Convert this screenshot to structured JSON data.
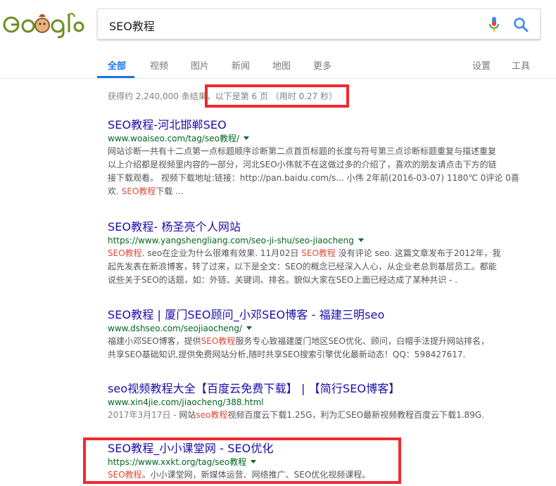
{
  "search": {
    "query": "SEO教程"
  },
  "logo": {
    "text": "Google"
  },
  "tabs": [
    {
      "label": "全部"
    },
    {
      "label": "视频"
    },
    {
      "label": "图片"
    },
    {
      "label": "新闻"
    },
    {
      "label": "地图"
    },
    {
      "label": "更多"
    },
    {
      "label": "设置"
    },
    {
      "label": "工具"
    }
  ],
  "stats": {
    "count": "获得约 2,240,000 条结果，",
    "page": "以下是第 6 页 （用时 0.27 秒）"
  },
  "results": [
    {
      "title": "SEO教程-河北邯郸SEO",
      "url": "www.woaiseo.com/tag/seo教程/",
      "lines": [
        [
          "网站诊断一共有十二点第一点标题顺序诊断第二点首页标题的长度与符号第三点诊断标题重复与描述重复"
        ],
        [
          "以上介绍都是视频里内容的一部分，河北SEO小伟就不在这做过多的介绍了，喜欢的朋友请点击下方的链"
        ],
        [
          "接下载观看。 视频下载地址:链接：http://pan.baidu.com/s... 小伟 2年前(2016-03-07) 1180℃ 0评论 0喜"
        ],
        [
          "欢. ",
          "SEO教程",
          "下载 ..."
        ]
      ]
    },
    {
      "title": "SEO教程- 杨圣亮个人网站",
      "url": "https://www.yangshengliang.com/seo-ji-shu/seo-jiaocheng",
      "lines": [
        [
          "",
          "SEO教程",
          ". seo在企业为什么很难有效果. 11月02日 ",
          "SEO教程",
          " 没有评论 seo. 这篇文章发布于2012年，我"
        ],
        [
          "起先发表在新浪博客，转了过来，以下是全文：SEO的概念已经深入人心，从企业老总到基层员工。都能"
        ],
        [
          "说些关于SEO的话题，如：外链、关键词、排名。貌似大家在SEO上面已经达成了某种共识 - ."
        ]
      ]
    },
    {
      "title": "SEO教程 | 厦门SEO顾问_小邓SEO博客 - 福建三明seo",
      "url": "www.dshseo.com/seojiaocheng/",
      "lines": [
        [
          "福建小邓SEO博客，提供",
          "SEO教程",
          "服务专心致福建厦门地区SEO优化、顾问，白帽手法提升网站排名，"
        ],
        [
          "共享SEO基础知识,提供免费网站分析,随时共享SEO搜索引擎优化最新动态！QQ：598427617."
        ]
      ]
    },
    {
      "title": "seo视频教程大全【百度云免费下载】 | 【简行SEO博客】",
      "url": "www.xin4jie.com/jiaocheng/388.html",
      "date": "2017年3月17日 - ",
      "lines": [
        [
          "网站",
          "seo教程",
          "视频百度云下载1.25G，利为汇SEO最新视频教程百度云下载1.89G."
        ]
      ]
    },
    {
      "title": "SEO教程_小小课堂网 - SEO优化",
      "url": "https://www.xxkt.org/tag/seo教程",
      "lines": [
        [
          "",
          "SEO教程",
          "。小小课堂网，新媒体运营、网络推广、SEO优化视频课程。"
        ]
      ]
    }
  ],
  "colors": {
    "link": "#1a0dab",
    "url": "#006621",
    "accent": "#1a73e8",
    "highlight": "#dd4b39",
    "annotation": "#ee2b2f"
  }
}
